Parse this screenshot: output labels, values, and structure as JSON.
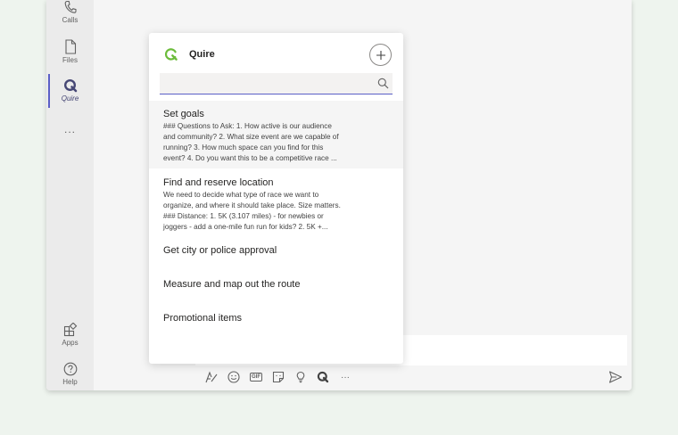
{
  "rail": {
    "items": [
      {
        "label": "Calls"
      },
      {
        "label": "Files"
      },
      {
        "label": "Quire"
      },
      {
        "label": "..."
      },
      {
        "label": "Apps"
      },
      {
        "label": "Help"
      }
    ]
  },
  "popup": {
    "title": "Quire",
    "search_placeholder": "",
    "items": [
      {
        "title": "Set goals",
        "desc_lines": [
          "### Questions to Ask: 1. How active is our audience",
          "and community? 2. What size event are we capable of",
          "running? 3. How much space can you find for this",
          "event? 4. Do you want this to be a competitive race ..."
        ]
      },
      {
        "title": "Find and reserve location",
        "desc_lines": [
          "We need to decide what type of race we want to",
          "organize, and where it should take place. Size matters.",
          "### Distance: 1. 5K (3.107 miles) - for newbies or",
          "joggers - add a one-mile fun run for kids? 2. 5K +..."
        ]
      },
      {
        "title": "Get city or police approval"
      },
      {
        "title": "Measure and map out the route"
      },
      {
        "title": "Promotional items"
      }
    ]
  },
  "toolbar": {
    "gif_label": "GIF",
    "more_label": "···"
  },
  "colors": {
    "accent": "#5b5fc7",
    "quire_green": "#6cbc3b",
    "rail_bg": "#ebebeb",
    "page_bg": "#eef4ee"
  }
}
